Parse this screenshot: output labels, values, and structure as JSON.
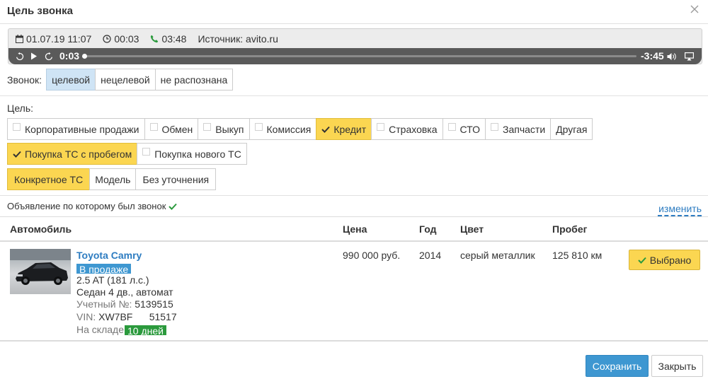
{
  "dialog": {
    "title": "Цель звонка"
  },
  "recording": {
    "date": "01.07.19 11:07",
    "duration": "00:03",
    "talk_time": "03:48",
    "source": "Источник: avito.ru",
    "current_time": "0:03",
    "remaining_time": "-3:45",
    "progress_percent": 1
  },
  "call": {
    "label": "Звонок:",
    "options": [
      {
        "label": "целевой",
        "selected": true
      },
      {
        "label": "нецелевой",
        "selected": false
      },
      {
        "label": "не распознана",
        "selected": false
      }
    ]
  },
  "goal": {
    "label": "Цель:",
    "options": [
      {
        "label": "Корпоративные продажи",
        "checked": false
      },
      {
        "label": "Обмен",
        "checked": false
      },
      {
        "label": "Выкуп",
        "checked": false
      },
      {
        "label": "Комиссия",
        "checked": false
      },
      {
        "label": "Кредит",
        "checked": true
      },
      {
        "label": "Страховка",
        "checked": false
      },
      {
        "label": "СТО",
        "checked": false
      },
      {
        "label": "Запчасти",
        "checked": false
      },
      {
        "label": "Другая",
        "checked": false
      }
    ],
    "vehicle_type": [
      {
        "label": "Покупка ТС с пробегом",
        "checked": true
      },
      {
        "label": "Покупка нового ТС",
        "checked": false
      }
    ],
    "specificity": [
      {
        "label": "Конкретное ТС",
        "selected": true
      },
      {
        "label": "Модель",
        "selected": false
      },
      {
        "label": "Без уточнения",
        "selected": false
      }
    ]
  },
  "ad": {
    "label": "Объявление по которому был звонок",
    "edit_link": "изменить"
  },
  "table": {
    "headers": {
      "car": "Автомобиль",
      "price": "Цена",
      "year": "Год",
      "color": "Цвет",
      "mileage": "Пробег"
    },
    "row": {
      "name": "Toyota Camry",
      "status": "В продаже",
      "engine": "2.5 AT (181 л.с.)",
      "body": "Седан 4 дв., автомат",
      "stock_label": "Учетный №:",
      "stock_value": "5139515",
      "vin_label": "VIN:",
      "vin_value": "XW7BF      51517",
      "warehouse_label": "На складе:",
      "warehouse_value": "10 дней",
      "price": "990 000 руб.",
      "year": "2014",
      "color": "серый металлик",
      "mileage": "125 810 км",
      "selected_label": "Выбрано"
    }
  },
  "footer": {
    "save_label": "Сохранить",
    "close_label": "Закрыть"
  },
  "colors": {
    "accent_blue": "#3e97d1",
    "selected_yellow": "#fbd651",
    "link_blue": "#2d7cc1",
    "check_green": "#2b9a3d"
  }
}
